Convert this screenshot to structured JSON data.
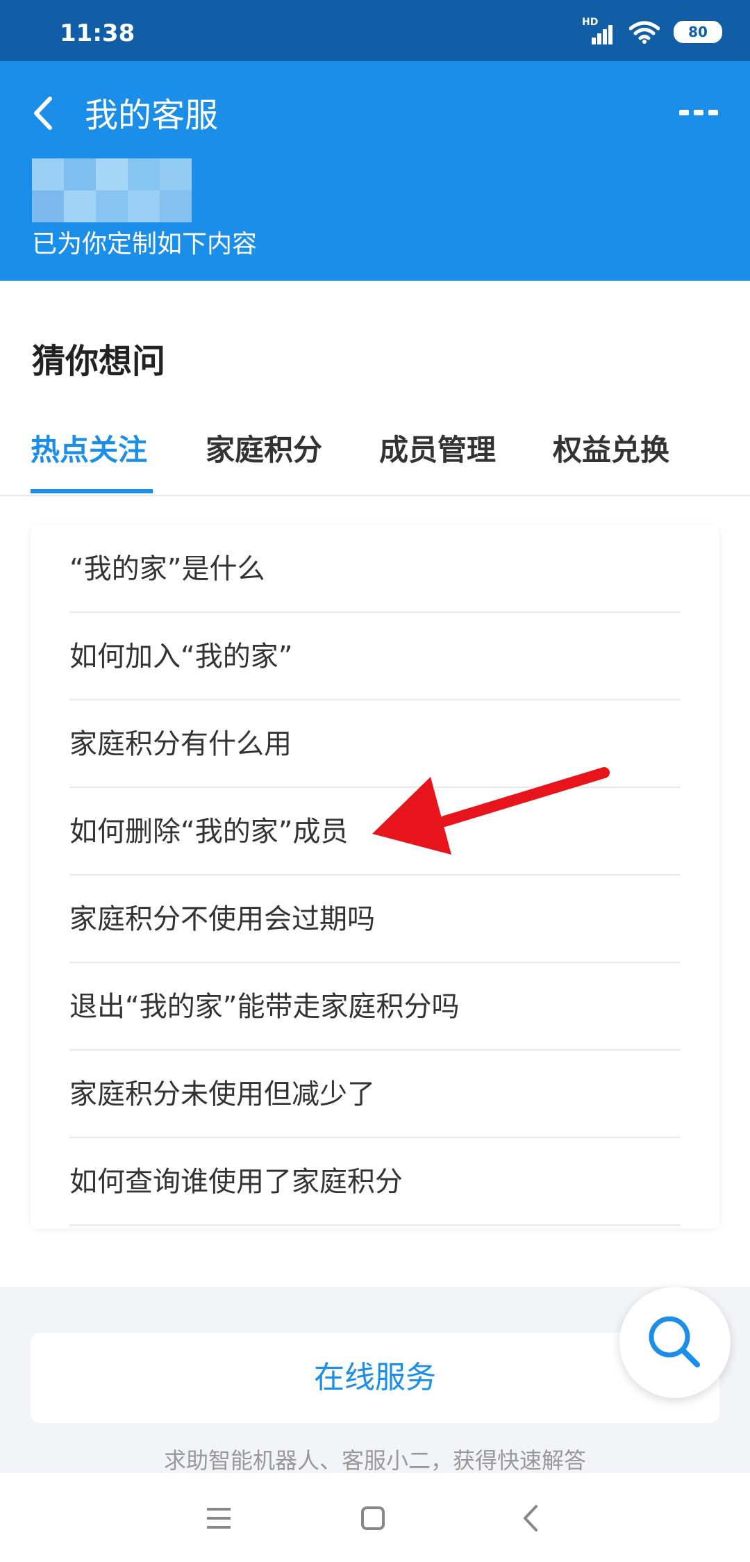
{
  "status_bar": {
    "time": "11:38",
    "network_label": "HD",
    "battery": "80"
  },
  "header": {
    "title": "我的客服",
    "subtitle": "已为你定制如下内容"
  },
  "section": {
    "title": "猜你想问"
  },
  "tabs": [
    "热点关注",
    "家庭积分",
    "成员管理",
    "权益兑换"
  ],
  "faq": [
    "“我的家”是什么",
    "如何加入“我的家”",
    "家庭积分有什么用",
    "如何删除“我的家”成员",
    "家庭积分不使用会过期吗",
    "退出“我的家”能带走家庭积分吗",
    "家庭积分未使用但减少了",
    "如何查询谁使用了家庭积分"
  ],
  "online_service": {
    "label": "在线服务",
    "description": "求助智能机器人、客服小二，获得快速解答"
  },
  "colors": {
    "primary": "#1a8ee8",
    "status_bar": "#115ea6",
    "annotation_arrow": "#e8141c"
  }
}
